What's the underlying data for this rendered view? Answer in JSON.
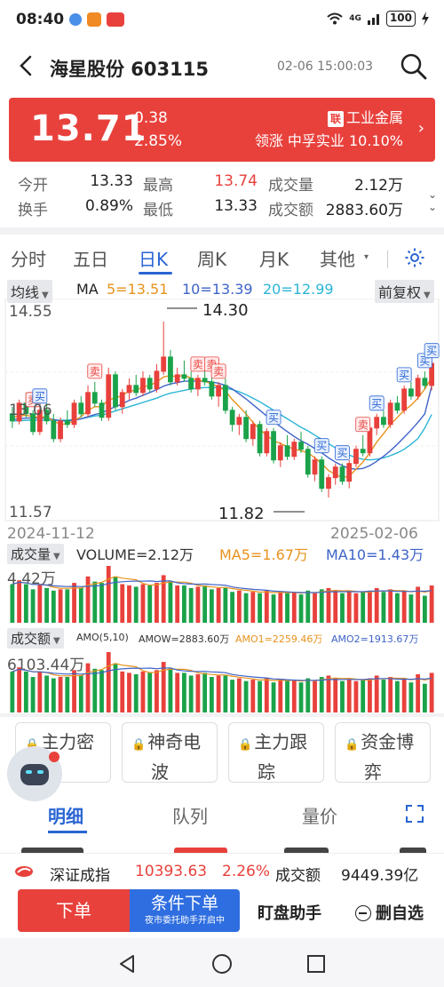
{
  "status": {
    "time": "08:40",
    "net": "4G",
    "battery": "100"
  },
  "header": {
    "title": "海星股份 603115",
    "datetime": "02-06 15:00:03"
  },
  "quote": {
    "price": "13.71",
    "change": "0.38",
    "change_pct": "2.85%",
    "lian_badge": "联",
    "sector": "工业金属",
    "leader": "领涨 中孚实业 10.10%"
  },
  "stats": [
    {
      "label": "今开",
      "value": "13.33"
    },
    {
      "label": "最高",
      "value": "13.74"
    },
    {
      "label": "成交量",
      "value": "2.12万"
    },
    {
      "label": "换手",
      "value": "0.89%"
    },
    {
      "label": "最低",
      "value": "13.33"
    },
    {
      "label": "成交额",
      "value": "2883.60万"
    }
  ],
  "tabs": [
    "分时",
    "五日",
    "日K",
    "周K",
    "月K",
    "其他"
  ],
  "active_tab": "日K",
  "ma": {
    "selector": "均线",
    "label": "MA",
    "ma5": "5=13.51",
    "ma10": "10=13.39",
    "ma20": "20=12.99",
    "adjust": "前复权"
  },
  "colors": {
    "up": "#e8413c",
    "down": "#1aa34a",
    "ma5": "#e8921c",
    "ma10": "#3e63c8",
    "ma20": "#2bb5d6",
    "accent": "#2a65d3"
  },
  "chart_data": {
    "type": "candlestick",
    "ytick_labels": [
      "14.55",
      "13.06",
      "11.57"
    ],
    "ylim": [
      11.57,
      14.55
    ],
    "x_start": "2024-11-12",
    "x_end": "2025-02-06",
    "max_label": "14.30",
    "min_label": "11.82",
    "buy_marker": "买",
    "sell_marker": "卖",
    "ohlc": [
      [
        13.0,
        13.1,
        12.8,
        12.9
      ],
      [
        12.9,
        13.2,
        12.85,
        13.15
      ],
      [
        13.15,
        13.3,
        12.95,
        13.0
      ],
      [
        13.0,
        13.05,
        12.7,
        12.75
      ],
      [
        12.75,
        13.1,
        12.7,
        13.05
      ],
      [
        13.05,
        13.15,
        12.85,
        12.9
      ],
      [
        12.9,
        13.0,
        12.6,
        12.65
      ],
      [
        12.65,
        12.95,
        12.6,
        12.9
      ],
      [
        12.9,
        13.05,
        12.8,
        12.85
      ],
      [
        12.85,
        13.2,
        12.8,
        13.15
      ],
      [
        13.15,
        13.25,
        12.95,
        13.0
      ],
      [
        13.0,
        13.4,
        12.95,
        13.3
      ],
      [
        13.3,
        13.45,
        13.1,
        13.15
      ],
      [
        13.15,
        13.2,
        12.9,
        12.95
      ],
      [
        12.95,
        13.65,
        12.9,
        13.55
      ],
      [
        13.55,
        13.6,
        13.05,
        13.1
      ],
      [
        13.1,
        13.35,
        13.0,
        13.3
      ],
      [
        13.3,
        13.5,
        13.2,
        13.4
      ],
      [
        13.4,
        13.55,
        13.25,
        13.3
      ],
      [
        13.3,
        13.6,
        13.25,
        13.5
      ],
      [
        13.5,
        13.55,
        13.3,
        13.35
      ],
      [
        13.35,
        13.7,
        13.3,
        13.6
      ],
      [
        13.6,
        14.3,
        13.55,
        13.8
      ],
      [
        13.8,
        13.9,
        13.4,
        13.45
      ],
      [
        13.45,
        13.65,
        13.4,
        13.55
      ],
      [
        13.55,
        13.75,
        13.45,
        13.5
      ],
      [
        13.5,
        13.6,
        13.3,
        13.35
      ],
      [
        13.35,
        13.55,
        13.25,
        13.5
      ],
      [
        13.5,
        13.7,
        13.4,
        13.45
      ],
      [
        13.45,
        13.55,
        13.2,
        13.25
      ],
      [
        13.25,
        13.45,
        13.1,
        13.4
      ],
      [
        13.4,
        13.5,
        13.0,
        13.05
      ],
      [
        13.05,
        13.1,
        12.75,
        12.85
      ],
      [
        12.85,
        13.0,
        12.7,
        12.95
      ],
      [
        12.95,
        13.05,
        12.6,
        12.65
      ],
      [
        12.65,
        12.9,
        12.55,
        12.85
      ],
      [
        12.85,
        12.9,
        12.4,
        12.45
      ],
      [
        12.45,
        12.8,
        12.4,
        12.75
      ],
      [
        12.75,
        12.8,
        12.3,
        12.35
      ],
      [
        12.35,
        12.6,
        12.25,
        12.55
      ],
      [
        12.55,
        12.7,
        12.35,
        12.4
      ],
      [
        12.4,
        12.65,
        12.35,
        12.6
      ],
      [
        12.6,
        12.75,
        12.45,
        12.5
      ],
      [
        12.5,
        12.55,
        12.1,
        12.15
      ],
      [
        12.15,
        12.4,
        12.05,
        12.35
      ],
      [
        12.35,
        12.4,
        11.9,
        11.95
      ],
      [
        11.95,
        12.15,
        11.82,
        12.1
      ],
      [
        12.1,
        12.3,
        12.0,
        12.25
      ],
      [
        12.25,
        12.3,
        12.0,
        12.05
      ],
      [
        12.05,
        12.35,
        11.95,
        12.3
      ],
      [
        12.3,
        12.55,
        12.25,
        12.5
      ],
      [
        12.5,
        12.7,
        12.4,
        12.45
      ],
      [
        12.45,
        12.85,
        12.4,
        12.8
      ],
      [
        12.8,
        13.0,
        12.7,
        12.95
      ],
      [
        12.95,
        13.05,
        12.8,
        12.85
      ],
      [
        12.85,
        13.2,
        12.8,
        13.15
      ],
      [
        13.15,
        13.25,
        13.0,
        13.05
      ],
      [
        13.05,
        13.4,
        13.0,
        13.35
      ],
      [
        13.35,
        13.45,
        13.2,
        13.25
      ],
      [
        13.25,
        13.55,
        13.2,
        13.5
      ],
      [
        13.5,
        13.6,
        13.35,
        13.4
      ],
      [
        13.4,
        13.74,
        13.33,
        13.71
      ]
    ],
    "ma5_series": [
      12.95,
      12.97,
      12.98,
      12.96,
      12.95,
      12.96,
      12.9,
      12.85,
      12.86,
      12.9,
      12.96,
      13.05,
      13.1,
      13.1,
      13.2,
      13.22,
      13.26,
      13.32,
      13.33,
      13.38,
      13.4,
      13.45,
      13.52,
      13.54,
      13.52,
      13.55,
      13.5,
      13.47,
      13.46,
      13.42,
      13.38,
      13.32,
      13.2,
      13.1,
      13.0,
      12.88,
      12.78,
      12.7,
      12.62,
      12.58,
      12.54,
      12.5,
      12.48,
      12.45,
      12.38,
      12.3,
      12.2,
      12.15,
      12.1,
      12.12,
      12.22,
      12.32,
      12.45,
      12.6,
      12.72,
      12.85,
      12.95,
      13.05,
      13.12,
      13.22,
      13.35,
      13.51
    ],
    "ma10_series": [
      12.92,
      12.93,
      12.94,
      12.94,
      12.94,
      12.94,
      12.92,
      12.9,
      12.9,
      12.91,
      12.93,
      12.96,
      12.99,
      13.01,
      13.06,
      13.1,
      13.14,
      13.19,
      13.22,
      13.26,
      13.3,
      13.34,
      13.39,
      13.42,
      13.44,
      13.46,
      13.46,
      13.46,
      13.46,
      13.45,
      13.43,
      13.4,
      13.35,
      13.28,
      13.21,
      13.13,
      13.05,
      12.97,
      12.89,
      12.82,
      12.75,
      12.68,
      12.62,
      12.57,
      12.51,
      12.45,
      12.38,
      12.32,
      12.27,
      12.23,
      12.22,
      12.23,
      12.27,
      12.33,
      12.4,
      12.48,
      12.57,
      12.67,
      12.77,
      12.88,
      13.0,
      13.39
    ],
    "ma20_series": [
      12.9,
      12.9,
      12.91,
      12.91,
      12.91,
      12.91,
      12.91,
      12.91,
      12.91,
      12.92,
      12.93,
      12.95,
      12.97,
      12.98,
      13.01,
      13.04,
      13.07,
      13.1,
      13.13,
      13.16,
      13.19,
      13.22,
      13.26,
      13.29,
      13.31,
      13.33,
      13.35,
      13.36,
      13.37,
      13.37,
      13.37,
      13.36,
      13.34,
      13.31,
      13.27,
      13.22,
      13.17,
      13.11,
      13.05,
      12.99,
      12.93,
      12.87,
      12.81,
      12.76,
      12.7,
      12.64,
      12.58,
      12.52,
      12.46,
      12.42,
      12.38,
      12.36,
      12.35,
      12.36,
      12.38,
      12.41,
      12.45,
      12.5,
      12.57,
      12.65,
      12.8,
      12.99
    ],
    "volume_series": [
      3.0,
      3.3,
      3.0,
      2.6,
      3.0,
      2.7,
      2.5,
      2.6,
      2.6,
      3.1,
      2.7,
      3.6,
      3.2,
      3.1,
      4.42,
      3.6,
      3.0,
      2.9,
      2.8,
      3.0,
      2.9,
      3.1,
      3.7,
      3.2,
      2.9,
      2.9,
      2.7,
      2.8,
      2.9,
      2.6,
      2.7,
      2.7,
      2.4,
      2.5,
      2.3,
      2.4,
      2.3,
      2.5,
      2.2,
      2.4,
      2.3,
      2.4,
      2.2,
      2.5,
      2.3,
      2.6,
      2.7,
      2.5,
      2.3,
      2.4,
      2.3,
      2.4,
      2.5,
      2.7,
      2.4,
      2.6,
      2.3,
      2.5,
      2.2,
      2.8,
      2.1,
      2.9
    ]
  },
  "volume": {
    "selector": "成交量",
    "vol": "VOLUME=2.12万",
    "ma5": "MA5=1.67万",
    "ma10": "MA10=1.43万",
    "max": "4.42万"
  },
  "amount": {
    "selector": "成交额",
    "amo": "AMO(5,10)",
    "amow": "AMOW=2883.60万",
    "amo1": "AMO1=2259.46万",
    "amo2": "AMO2=1913.67万",
    "max": "6103.44万"
  },
  "features": [
    {
      "line1": "主力密",
      "line2": "码"
    },
    {
      "line1": "神奇电",
      "line2": "波"
    },
    {
      "line1": "主力跟",
      "line2": "踪"
    },
    {
      "line1": "资金博",
      "line2": "弈"
    }
  ],
  "subtabs": [
    "明细",
    "队列",
    "量价"
  ],
  "index": {
    "name": "深证成指",
    "value": "10393.63",
    "pct": "2.26%",
    "amt_label": "成交额",
    "amt_value": "9449.39亿"
  },
  "actions": {
    "order": "下单",
    "cond_order": "条件下单",
    "cond_sub": "夜市委托助手开启中",
    "assist": "盯盘助手",
    "remove": "删自选"
  }
}
